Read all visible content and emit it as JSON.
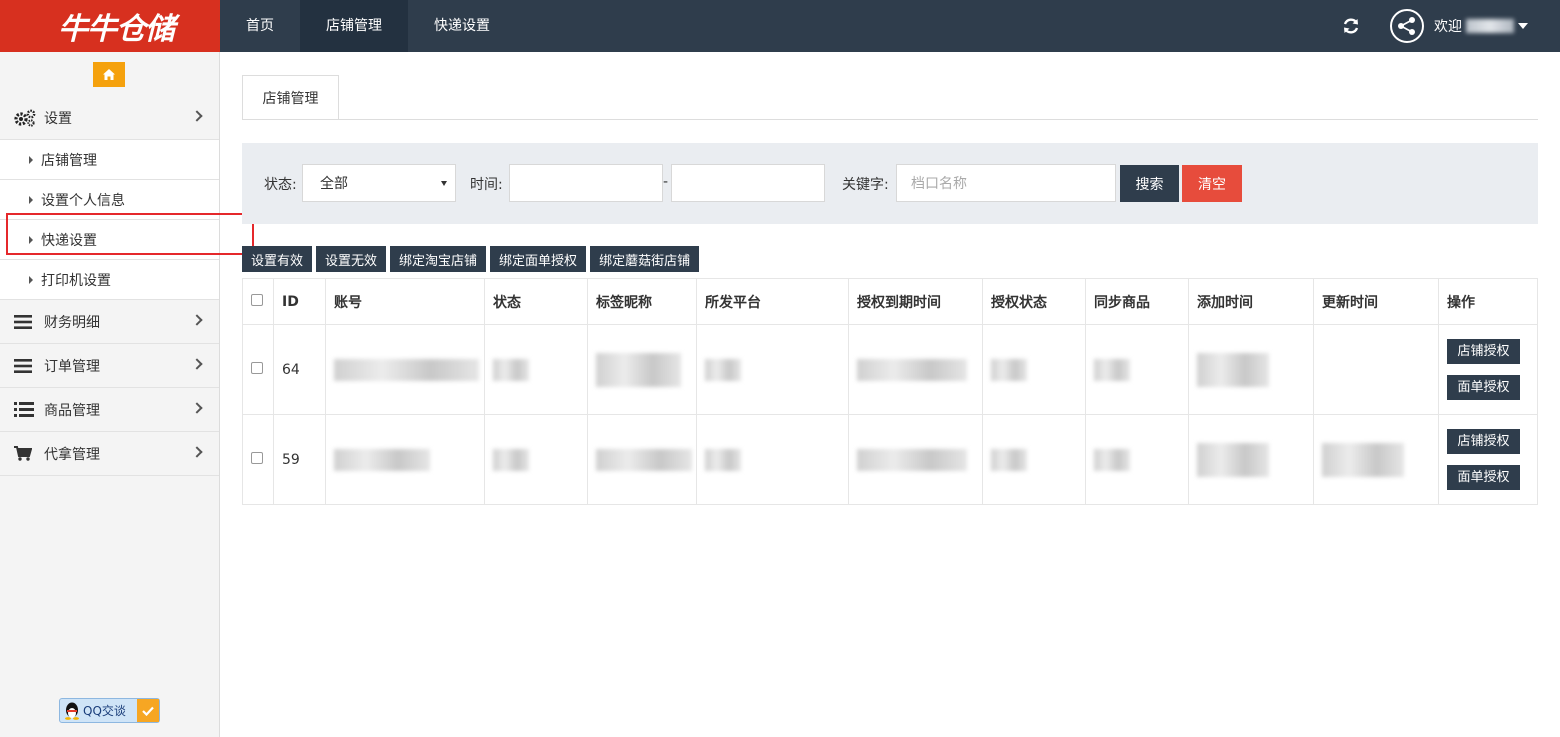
{
  "brand": {
    "logo_text": "牛牛仓储",
    "color": "#d7301f"
  },
  "topnav": {
    "items": [
      "首页",
      "店铺管理",
      "快递设置"
    ],
    "active": "店铺管理"
  },
  "header": {
    "welcome": "欢迎"
  },
  "sidebar": {
    "settings_label": "设置",
    "sub_items": [
      "店铺管理",
      "设置个人信息",
      "快递设置",
      "打印机设置"
    ],
    "groups": [
      "财务明细",
      "订单管理",
      "商品管理",
      "代拿管理"
    ],
    "qq_label": "QQ交谈"
  },
  "main": {
    "tab_label": "店铺管理",
    "filter": {
      "status_label": "状态:",
      "status_value": "全部",
      "time_label": "时间:",
      "time_separator": "-",
      "keyword_label": "关键字:",
      "keyword_placeholder": "档口名称",
      "search_label": "搜索",
      "clear_label": "清空"
    },
    "actions": [
      "设置有效",
      "设置无效",
      "绑定淘宝店铺",
      "绑定面单授权",
      "绑定蘑菇街店铺"
    ],
    "table": {
      "headers": [
        "ID",
        "账号",
        "状态",
        "标签昵称",
        "所发平台",
        "授权到期时间",
        "授权状态",
        "同步商品",
        "添加时间",
        "更新时间",
        "操作"
      ],
      "rows": [
        {
          "id": "64",
          "op1": "店铺授权",
          "op2": "面单授权"
        },
        {
          "id": "59",
          "op1": "店铺授权",
          "op2": "面单授权"
        }
      ]
    }
  },
  "colors": {
    "topbar": "#2f3d4c",
    "accent_orange": "#f5a10d",
    "danger": "#e74c3c",
    "highlight": "#e5282b"
  }
}
